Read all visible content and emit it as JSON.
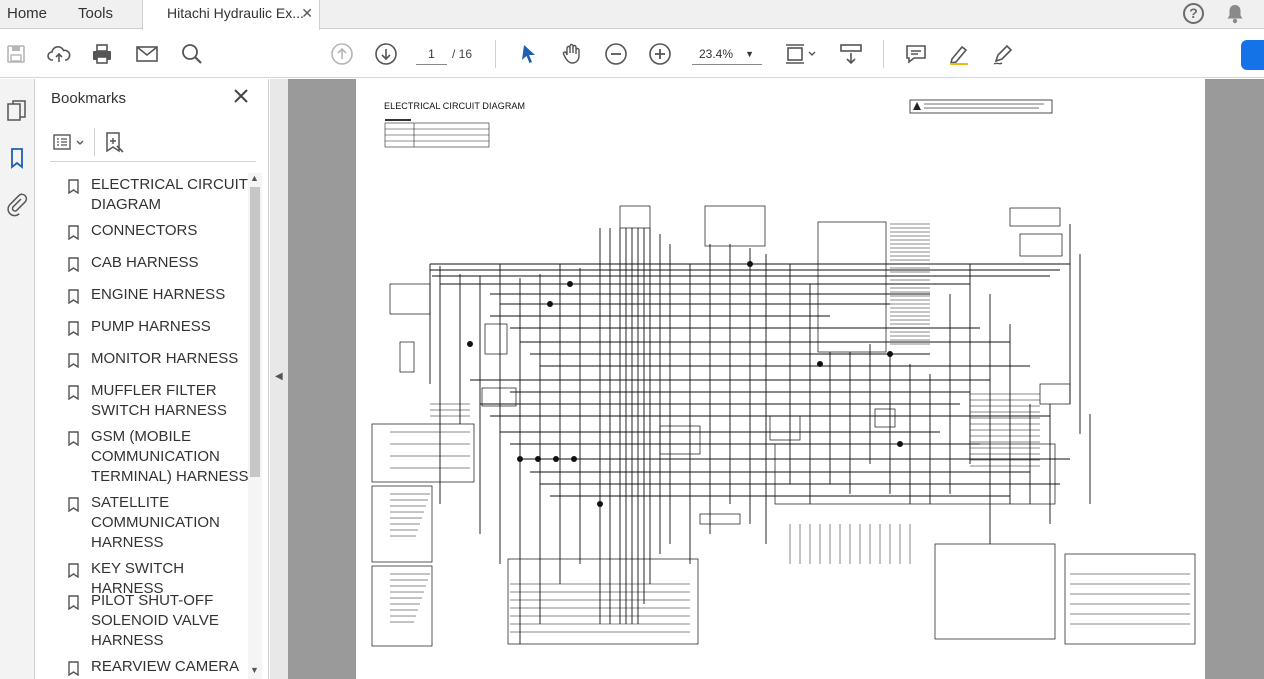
{
  "tabs": {
    "home": "Home",
    "tools": "Tools",
    "document": "Hitachi Hydraulic Ex..."
  },
  "header": {
    "help": "?"
  },
  "toolbar": {
    "current_page": "1",
    "total_pages": "/ 16",
    "zoom": "23.4%"
  },
  "bookmarks": {
    "title": "Bookmarks",
    "items": [
      {
        "label": "ELECTRICAL CIRCUIT DIAGRAM"
      },
      {
        "label": "CONNECTORS"
      },
      {
        "label": "CAB HARNESS"
      },
      {
        "label": "ENGINE HARNESS"
      },
      {
        "label": "PUMP HARNESS"
      },
      {
        "label": "MONITOR HARNESS"
      },
      {
        "label": "MUFFLER FILTER SWITCH HARNESS"
      },
      {
        "label": "GSM (MOBILE COMMUNICATION TERMINAL) HARNESS"
      },
      {
        "label": "SATELLITE COMMUNICATION HARNESS"
      },
      {
        "label": "KEY SWITCH HARNESS"
      },
      {
        "label": "PILOT SHUT-OFF SOLENOID VALVE HARNESS"
      },
      {
        "label": "REARVIEW CAMERA"
      }
    ]
  },
  "document": {
    "page_title": "ELECTRICAL CIRCUIT DIAGRAM"
  },
  "colors": {
    "accent": "#1473e6",
    "panel_bg": "#f3f3f3",
    "doc_bg": "#9a9a9a"
  }
}
